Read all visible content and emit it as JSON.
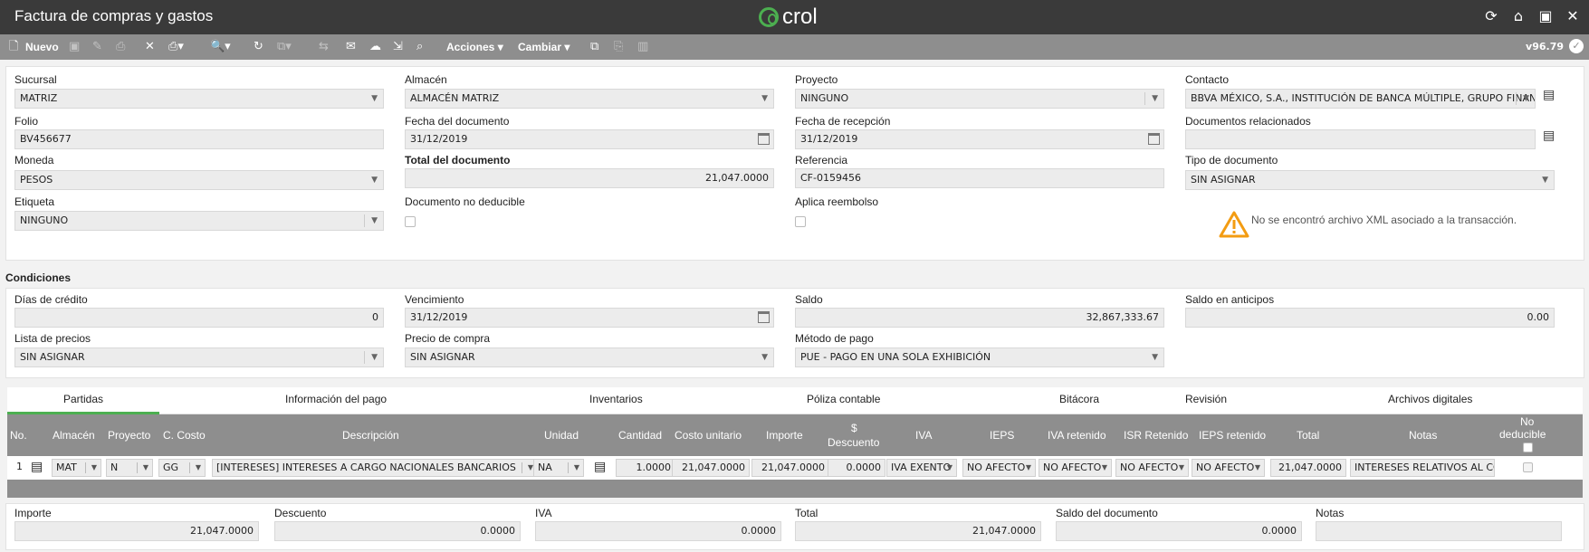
{
  "window": {
    "title": "Factura de compras y gastos",
    "logo_text": "crol"
  },
  "titlebar_icons": [
    "refresh-icon",
    "home-icon",
    "window-icon",
    "close-icon"
  ],
  "toolbar": {
    "new_label": "Nuevo",
    "actions_label": "Acciones",
    "change_label": "Cambiar",
    "version": "v96.79"
  },
  "form": {
    "sucursal": {
      "label": "Sucursal",
      "value": "MATRIZ"
    },
    "almacen": {
      "label": "Almacén",
      "value": "ALMACÉN MATRIZ"
    },
    "proyecto": {
      "label": "Proyecto",
      "value": "NINGUNO"
    },
    "contacto": {
      "label": "Contacto",
      "value": "BBVA MÉXICO, S.A., INSTITUCIÓN DE BANCA MÚLTIPLE, GRUPO FINAN"
    },
    "folio": {
      "label": "Folio",
      "value": "BV456677"
    },
    "fecha_documento": {
      "label": "Fecha del documento",
      "value": "31/12/2019"
    },
    "fecha_recepcion": {
      "label": "Fecha de recepción",
      "value": "31/12/2019"
    },
    "documentos_relacionados": {
      "label": "Documentos relacionados",
      "value": ""
    },
    "moneda": {
      "label": "Moneda",
      "value": "PESOS"
    },
    "total_documento": {
      "label": "Total del documento",
      "value": "21,047.0000"
    },
    "referencia": {
      "label": "Referencia",
      "value": "CF-0159456"
    },
    "tipo_documento": {
      "label": "Tipo de documento",
      "value": "SIN ASIGNAR"
    },
    "etiqueta": {
      "label": "Etiqueta",
      "value": "NINGUNO"
    },
    "no_deducible": {
      "label": "Documento no deducible"
    },
    "aplica_reembolso": {
      "label": "Aplica reembolso"
    },
    "xml_warning": "No se encontró archivo XML asociado a la transacción."
  },
  "condiciones": {
    "title": "Condiciones",
    "dias_credito": {
      "label": "Días de crédito",
      "value": "0"
    },
    "vencimiento": {
      "label": "Vencimiento",
      "value": "31/12/2019"
    },
    "saldo": {
      "label": "Saldo",
      "value": "32,867,333.67"
    },
    "saldo_anticipos": {
      "label": "Saldo en anticipos",
      "value": "0.00"
    },
    "lista_precios": {
      "label": "Lista de precios",
      "value": "SIN ASIGNAR"
    },
    "precio_compra": {
      "label": "Precio de compra",
      "value": "SIN ASIGNAR"
    },
    "metodo_pago": {
      "label": "Método de pago",
      "value": "PUE - PAGO EN UNA SOLA EXHIBICIÓN"
    }
  },
  "tabs": [
    "Partidas",
    "Información del pago",
    "Inventarios",
    "Póliza contable",
    "Bitácora",
    "Revisión",
    "Archivos digitales"
  ],
  "grid": {
    "headers": {
      "no": "No.",
      "almacen": "Almacén",
      "proyecto": "Proyecto",
      "ccosto": "C. Costo",
      "descripcion": "Descripción",
      "unidad": "Unidad",
      "cantidad": "Cantidad",
      "costo_unitario": "Costo unitario",
      "importe": "Importe",
      "descuento_1": "$",
      "descuento_2": "Descuento",
      "iva": "IVA",
      "ieps": "IEPS",
      "iva_retenido": "IVA retenido",
      "isr_retenido": "ISR Retenido",
      "ieps_retenido": "IEPS retenido",
      "total": "Total",
      "notas": "Notas",
      "no_deducible_1": "No",
      "no_deducible_2": "deducible"
    },
    "row": {
      "no": "1",
      "almacen": "MAT",
      "proyecto": "N",
      "ccosto": "GG",
      "descripcion": "[INTERESES] INTERESES A CARGO NACIONALES BANCARIOS",
      "unidad": "NA",
      "cantidad": "1.0000",
      "costo_unitario": "21,047.0000",
      "importe": "21,047.0000",
      "descuento": "0.0000",
      "iva": "IVA EXENTO",
      "ieps": "NO AFECTO",
      "iva_retenido": "NO AFECTO",
      "isr_retenido": "NO AFECTO",
      "ieps_retenido": "NO AFECTO",
      "total": "21,047.0000",
      "notas": "INTERESES RELATIVOS AL CC"
    }
  },
  "totals": {
    "importe": {
      "label": "Importe",
      "value": "21,047.0000"
    },
    "descuento": {
      "label": "Descuento",
      "value": "0.0000"
    },
    "iva": {
      "label": "IVA",
      "value": "0.0000"
    },
    "total": {
      "label": "Total",
      "value": "21,047.0000"
    },
    "saldo": {
      "label": "Saldo del documento",
      "value": "0.0000"
    },
    "notas": {
      "label": "Notas",
      "value": ""
    }
  }
}
